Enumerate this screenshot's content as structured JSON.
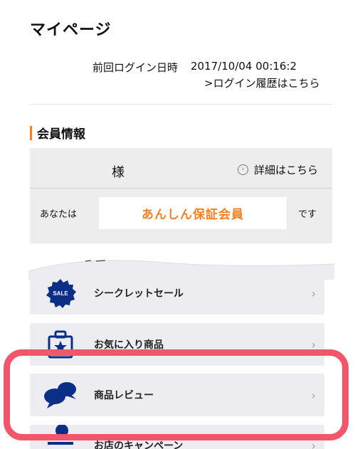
{
  "page": {
    "title": "マイページ"
  },
  "login": {
    "label": "前回ログイン日時",
    "datetime": "2017/10/04 00:16:2",
    "history_link": ">ログイン履歴はこちら"
  },
  "member": {
    "section_title": "会員情報",
    "name_suffix": "様",
    "detail_link": "詳細はこちら",
    "rank_prefix": "あなたは",
    "rank": "あんしん保証会員",
    "rank_suffix": "です"
  },
  "menu": {
    "items": [
      {
        "label": "シークレットセール",
        "icon": "sale-badge-icon",
        "chevron": "›"
      },
      {
        "label": "お気に入り商品",
        "icon": "favorite-bag-icon",
        "chevron": "›"
      },
      {
        "label": "商品レビュー",
        "icon": "speech-bubbles-icon",
        "chevron": "›"
      },
      {
        "label": "お店のキャンペーン",
        "icon": "campaign-icon",
        "chevron": "›"
      }
    ],
    "sale_badge_text": "SALE"
  },
  "colors": {
    "accent": "#f58220",
    "icon_blue": "#0b2f87",
    "highlight": "#f2566a",
    "menu_bg": "#ececf1"
  }
}
